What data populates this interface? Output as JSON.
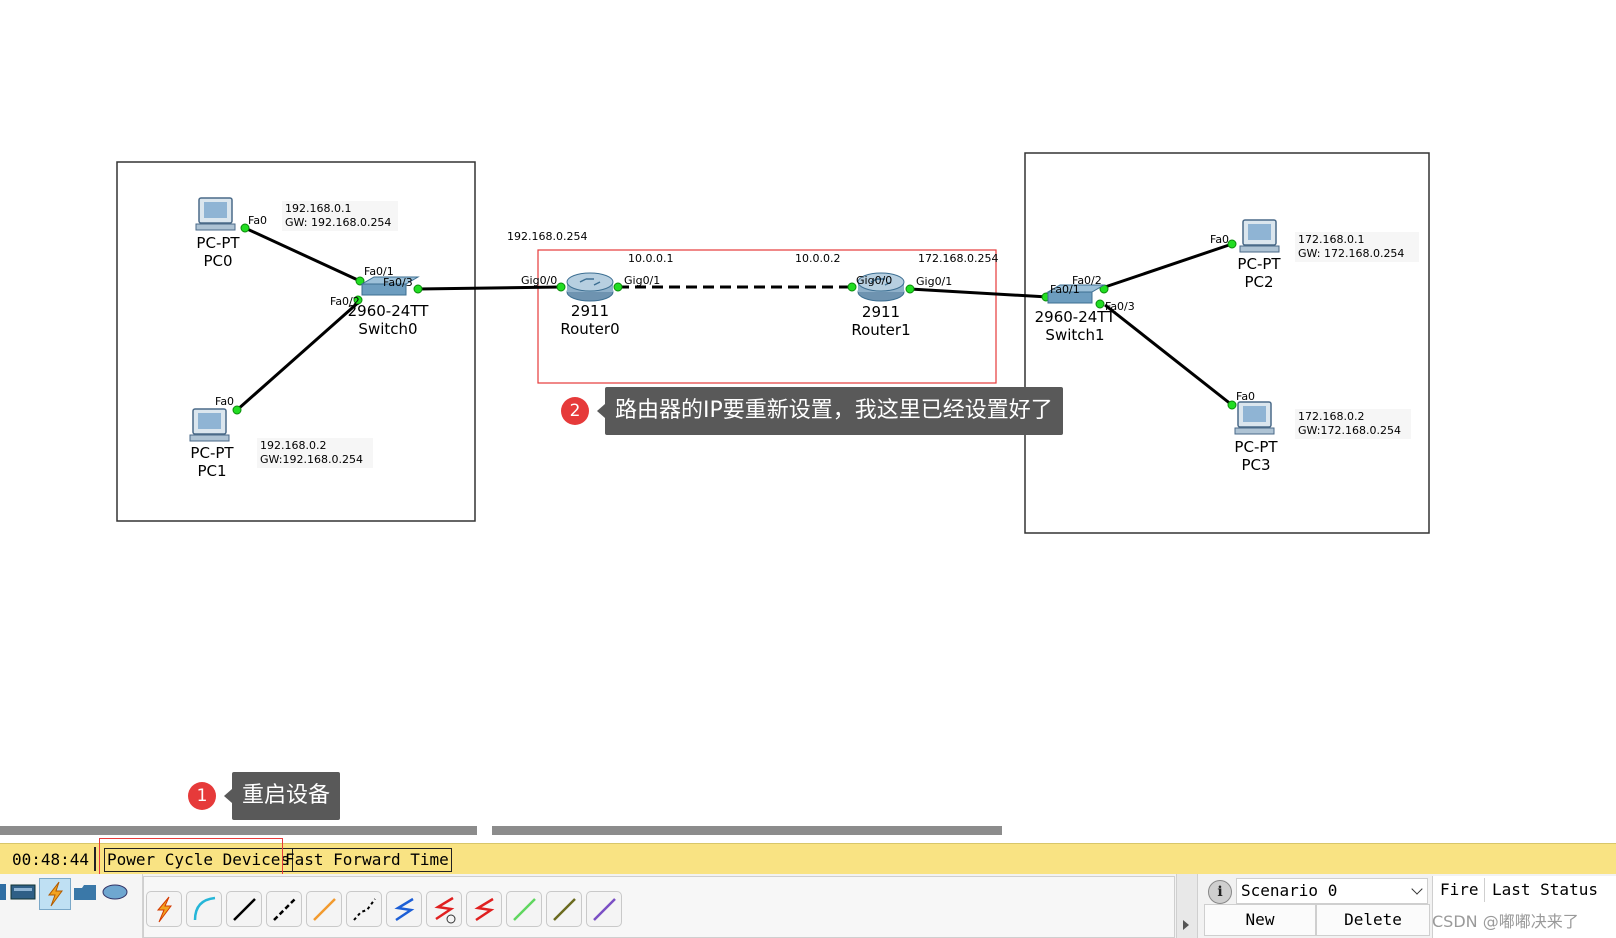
{
  "topology": {
    "devices": {
      "pc0": {
        "model": "PC-PT",
        "name": "PC0"
      },
      "pc1": {
        "model": "PC-PT",
        "name": "PC1"
      },
      "pc2": {
        "model": "PC-PT",
        "name": "PC2"
      },
      "pc3": {
        "model": "PC-PT",
        "name": "PC3"
      },
      "switch0": {
        "model": "2960-24TT",
        "name": "Switch0"
      },
      "switch1": {
        "model": "2960-24TT",
        "name": "Switch1"
      },
      "router0": {
        "model": "2911",
        "name": "Router0"
      },
      "router1": {
        "model": "2911",
        "name": "Router1"
      }
    },
    "ports": {
      "pc0_fa0": "Fa0",
      "pc1_fa0": "Fa0",
      "pc2_fa0": "Fa0",
      "pc3_fa0": "Fa0",
      "sw0_fa01": "Fa0/1",
      "sw0_fa02": "Fa0/2",
      "sw0_fa03": "Fa0/3",
      "sw1_fa01": "Fa0/1",
      "sw1_fa02": "Fa0/2",
      "sw1_fa03": "Fa0/3",
      "r0_gig00": "Gig0/0",
      "r0_gig01": "Gig0/1",
      "r1_gig00": "Gig0/0",
      "r1_gig01": "Gig0/1"
    },
    "notes": {
      "pc0_ip": "192.168.0.1",
      "pc0_gw": "GW:  192.168.0.254",
      "pc1_ip": "192.168.0.2",
      "pc1_gw": "GW:192.168.0.254",
      "pc2_ip": "172.168.0.1",
      "pc2_gw": "GW:  172.168.0.254",
      "pc3_ip": "172.168.0.2",
      "pc3_gw": "GW:172.168.0.254",
      "r0_g00_ip": "192.168.0.254",
      "r0_g01_ip": "10.0.0.1",
      "r1_g00_ip": "10.0.0.2",
      "r1_g01_ip": "172.168.0.254"
    }
  },
  "annotations": {
    "callout1": {
      "number": "1",
      "text": "重启设备"
    },
    "callout2": {
      "number": "2",
      "text": "路由器的IP要重新设置，我这里已经设置好了"
    }
  },
  "timebar": {
    "time": "00:48:44",
    "power_cycle_label": "Power Cycle Devices",
    "fast_forward_label": "Fast Forward Time"
  },
  "scenario": {
    "info_icon": "i",
    "selected": "Scenario 0",
    "new_label": "New",
    "delete_label": "Delete"
  },
  "pdu_list": {
    "fire_header": "Fire",
    "last_status_header": "Last Status"
  },
  "watermark": "CSDN @嘟嘟决来了",
  "colors": {
    "annotation_red": "#e63a3a",
    "callout_bg": "#595959",
    "timebar_bg": "#f9e383",
    "port_green": "#22dd22"
  }
}
